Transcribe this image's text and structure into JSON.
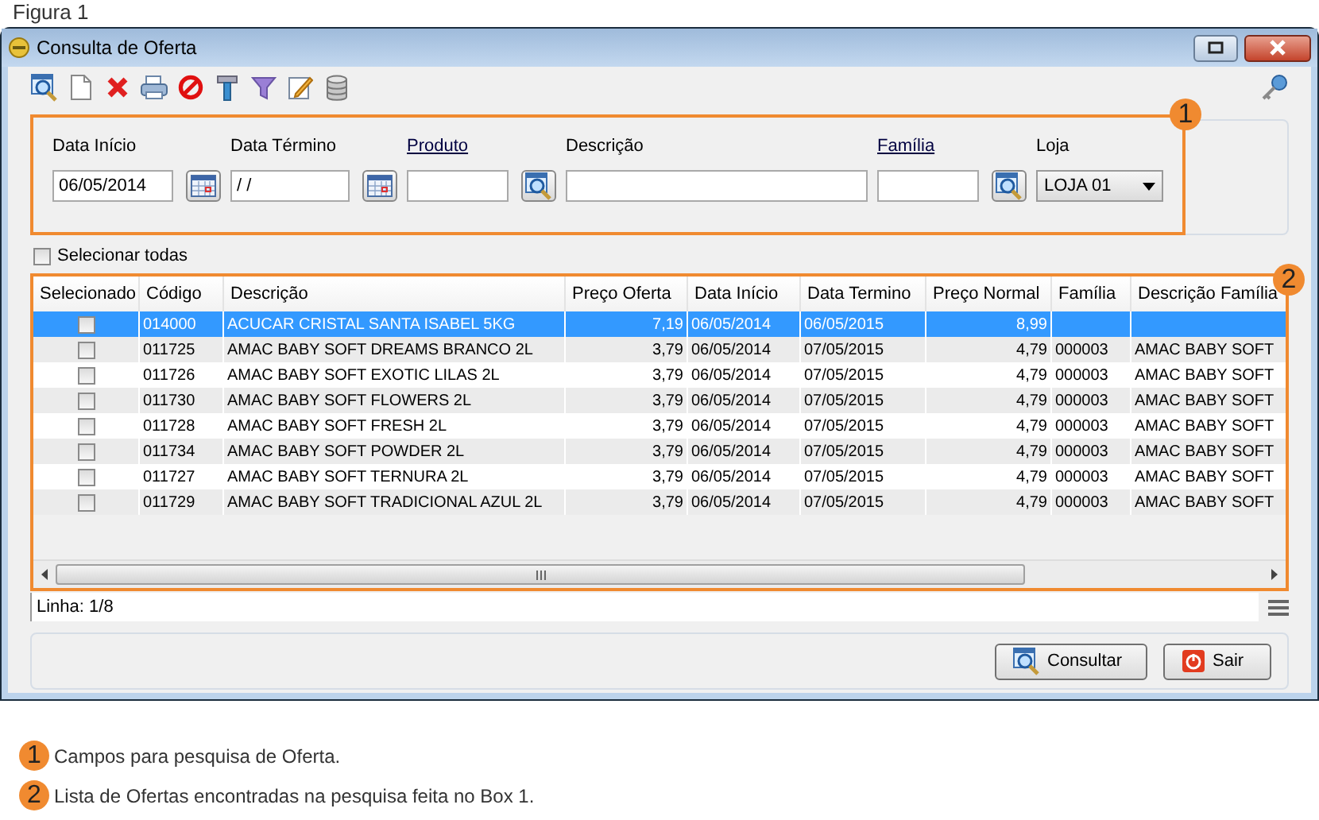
{
  "caption": "Figura 1",
  "window": {
    "title": "Consulta de Oferta"
  },
  "filter_panel": {
    "badge": "1",
    "fields": [
      {
        "kind": "date",
        "label": "Data Início",
        "value": "06/05/2014",
        "link": false
      },
      {
        "kind": "date",
        "label": "Data Término",
        "value": "/ /",
        "link": false
      },
      {
        "kind": "lookup",
        "label": "Produto",
        "link": true
      },
      {
        "kind": "text",
        "label": "Descrição",
        "link": false
      },
      {
        "kind": "lookup",
        "label": "Família",
        "link": true
      },
      {
        "kind": "select",
        "label": "Loja",
        "value": "LOJA 01",
        "link": false
      }
    ]
  },
  "select_all": {
    "label": "Selecionar todas",
    "checked": false
  },
  "grid": {
    "badge": "2",
    "columns": [
      {
        "label": "Selecionado",
        "kind": "check"
      },
      {
        "label": "Código",
        "kind": "text"
      },
      {
        "label": "Descrição",
        "kind": "text"
      },
      {
        "label": "Preço Oferta",
        "kind": "number"
      },
      {
        "label": "Data Início",
        "kind": "text"
      },
      {
        "label": "Data Termino",
        "kind": "text"
      },
      {
        "label": "Preço Normal",
        "kind": "number"
      },
      {
        "label": "Família",
        "kind": "text"
      },
      {
        "label": "Descrição Família",
        "kind": "text"
      }
    ],
    "rows": [
      {
        "selected": true,
        "checked": false,
        "cells": [
          "",
          "014000",
          "ACUCAR CRISTAL SANTA ISABEL 5KG",
          "7,19",
          "06/05/2014",
          "06/05/2015",
          "8,99",
          "",
          ""
        ]
      },
      {
        "selected": false,
        "checked": false,
        "cells": [
          "",
          "011725",
          "AMAC BABY SOFT DREAMS BRANCO 2L",
          "3,79",
          "06/05/2014",
          "07/05/2015",
          "4,79",
          "000003",
          "AMAC BABY SOFT"
        ]
      },
      {
        "selected": false,
        "checked": false,
        "cells": [
          "",
          "011726",
          "AMAC BABY SOFT EXOTIC LILAS 2L",
          "3,79",
          "06/05/2014",
          "07/05/2015",
          "4,79",
          "000003",
          "AMAC BABY SOFT"
        ]
      },
      {
        "selected": false,
        "checked": false,
        "cells": [
          "",
          "011730",
          "AMAC BABY SOFT FLOWERS 2L",
          "3,79",
          "06/05/2014",
          "07/05/2015",
          "4,79",
          "000003",
          "AMAC BABY SOFT"
        ]
      },
      {
        "selected": false,
        "checked": false,
        "cells": [
          "",
          "011728",
          "AMAC BABY SOFT FRESH 2L",
          "3,79",
          "06/05/2014",
          "07/05/2015",
          "4,79",
          "000003",
          "AMAC BABY SOFT"
        ]
      },
      {
        "selected": false,
        "checked": false,
        "cells": [
          "",
          "011734",
          "AMAC BABY SOFT POWDER 2L",
          "3,79",
          "06/05/2014",
          "07/05/2015",
          "4,79",
          "000003",
          "AMAC BABY SOFT"
        ]
      },
      {
        "selected": false,
        "checked": false,
        "cells": [
          "",
          "011727",
          "AMAC BABY SOFT TERNURA 2L",
          "3,79",
          "06/05/2014",
          "07/05/2015",
          "4,79",
          "000003",
          "AMAC BABY SOFT"
        ]
      },
      {
        "selected": false,
        "checked": false,
        "cells": [
          "",
          "011729",
          "AMAC BABY SOFT TRADICIONAL AZUL 2L",
          "3,79",
          "06/05/2014",
          "07/05/2015",
          "4,79",
          "000003",
          "AMAC BABY SOFT"
        ]
      }
    ]
  },
  "status_bar": "Linha: 1/8",
  "buttons": [
    {
      "label": "Consultar",
      "kind": "search"
    },
    {
      "label": "Sair",
      "kind": "exit"
    }
  ],
  "legend": [
    {
      "number": "1",
      "text": "Campos para pesquisa de Oferta."
    },
    {
      "number": "2",
      "text": "Lista de Ofertas encontradas na pesquisa feita no Box 1."
    }
  ]
}
